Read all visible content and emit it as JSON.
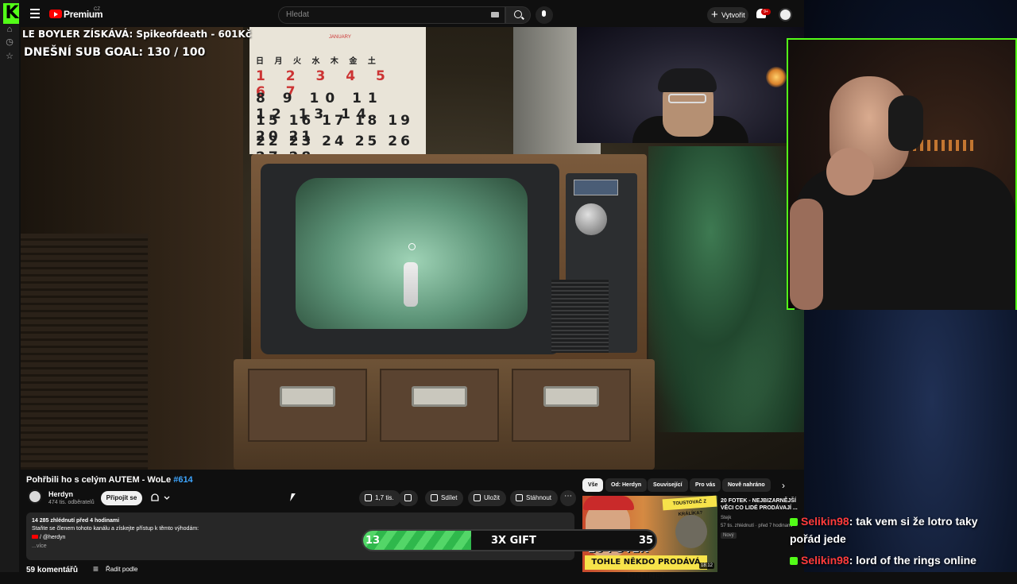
{
  "header": {
    "brand": "Premium",
    "region": "CZ",
    "search_placeholder": "Hledat",
    "create_label": "Vytvořit",
    "notifications_badge": "9+"
  },
  "stream_overlay": {
    "top_donor": "LE BOYLER ZÍSKÁVÁ: Spikeofdeath - 601Kč",
    "sub_goal": "DNEŠNÍ SUB GOAL: 130 / 100"
  },
  "tv_scene": {
    "calendar_month": "JANUARY",
    "calendar_rows": [
      "日 月 火 水 木 金 土",
      "1 2 3 4 5 6 7",
      "8 9 10 11 12 13 14",
      "15 16 17 18 19 20 21",
      "22 23 24 25 26 27 28"
    ]
  },
  "video": {
    "title": "Pohřbili ho s celým AUTEM - WoLe",
    "title_tag": "#614",
    "channel": "Herdyn",
    "subscribers": "474 tis. odběratelů",
    "join_label": "Připojit se",
    "like_count": "1,7 tis.",
    "share_label": "Sdílet",
    "save_label": "Uložit",
    "download_label": "Stáhnout"
  },
  "description": {
    "stats": "14 285 zhlédnutí  před 4 hodinami",
    "line": "Staňte se členem tohoto kanálu a získejte přístup k těmto výhodám:",
    "link": "/ @herdyn",
    "more": "...více"
  },
  "comments": {
    "count": "59 komentářů",
    "sort_label": "Řadit podle"
  },
  "chips": [
    "Vše",
    "Od: Herdyn",
    "Související",
    "Pro vás",
    "Nově nahráno"
  ],
  "recommended": {
    "title": "20 FOTEK - NEJBIZARNĚJŠÍ VĚCI CO LIDÉ PRODÁVAJÍ ...",
    "channel": "Stejk",
    "meta": "57 tis. zhlédnutí · před 7 hodinami",
    "badge": "Nový",
    "duration": "18:12",
    "thumb_badge": "TOUSTOVAČ Z KRÁLÍKA?",
    "thumb_big": "20 FOTEK",
    "thumb_banner": "TOHLE NĚKDO PRODÁVÁ ONLINE?"
  },
  "goal_bar": {
    "current": "13",
    "target": "35",
    "label": "3X GIFT",
    "progress": 0.37
  },
  "chat": [
    {
      "user": "Selikin98",
      "message": ": tak vem si že lotro taky"
    },
    {
      "user": "",
      "message": "pořád jede"
    },
    {
      "user": "Selikin98",
      "message": ": lord of the rings online"
    }
  ],
  "colors": {
    "kick_green": "#53fc18",
    "youtube_red": "#ff0000",
    "link_blue": "#3ea6ff",
    "chat_name": "#ff3b3b"
  }
}
